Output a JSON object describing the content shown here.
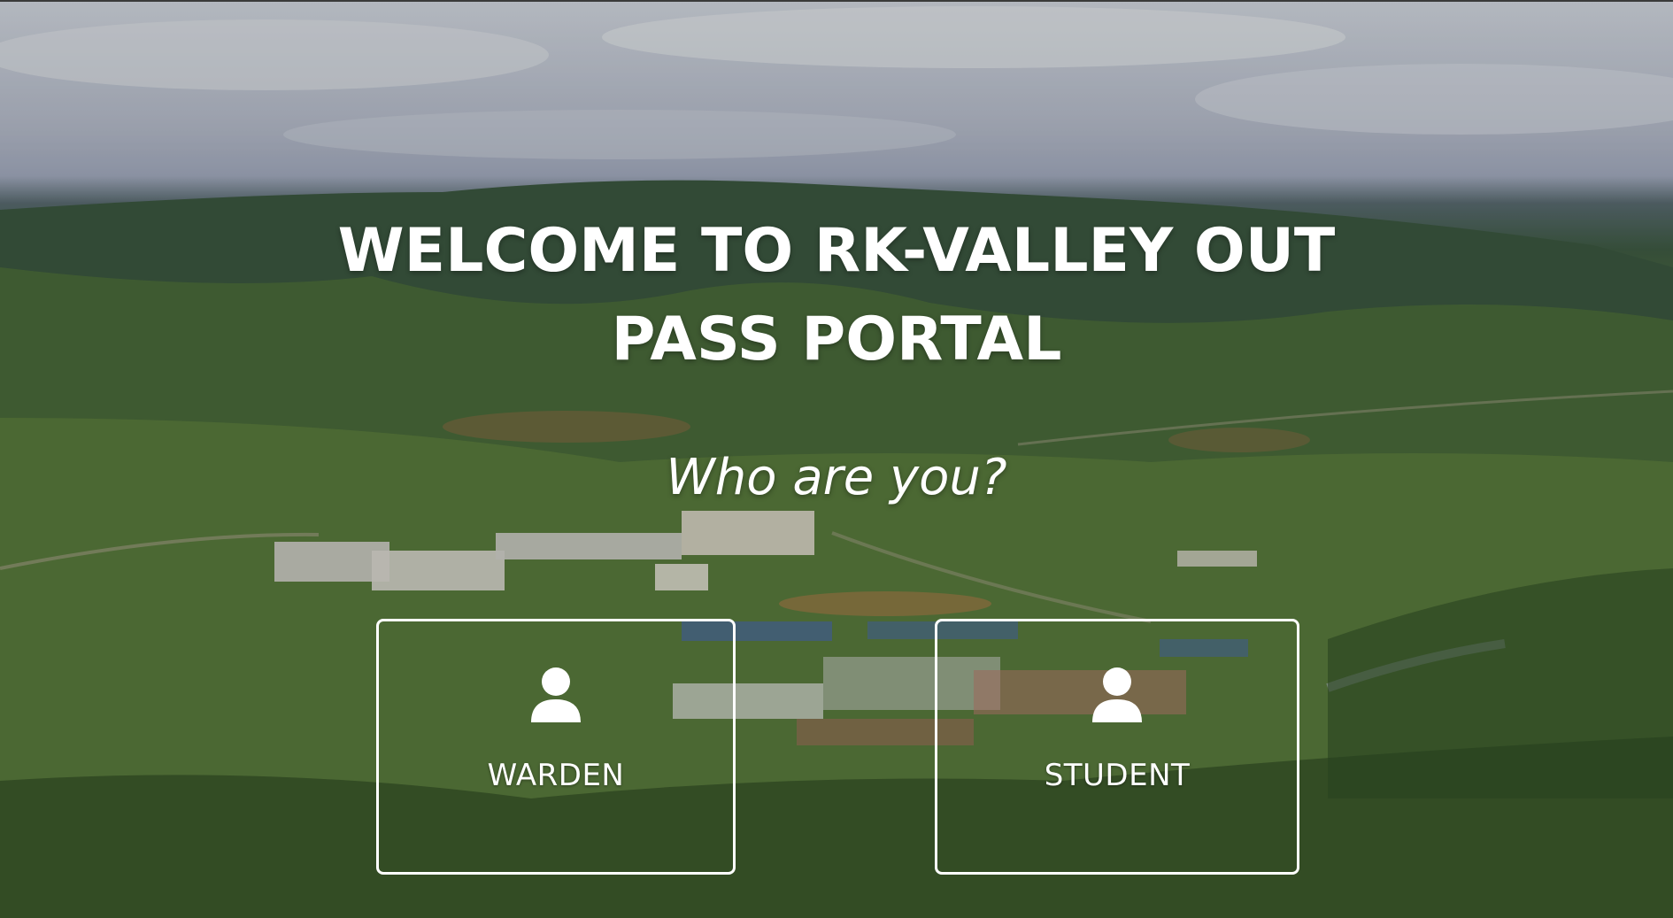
{
  "header": {
    "title": "WELCOME TO RK-VALLEY OUT PASS PORTAL"
  },
  "prompt": {
    "text": "Who are you?"
  },
  "roles": [
    {
      "label": "WARDEN",
      "icon": "user-icon"
    },
    {
      "label": "STUDENT",
      "icon": "user-icon"
    }
  ],
  "colors": {
    "text": "#ffffff",
    "card_border": "#ffffff",
    "hills": "#3f5a44",
    "vegetation": "#587638",
    "sky": "#c6cad9"
  }
}
